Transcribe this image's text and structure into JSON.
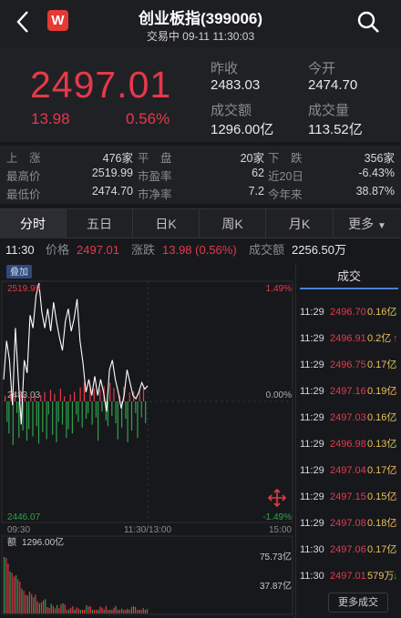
{
  "header": {
    "title": "创业板指(399006)",
    "subtitle": "交易中 09-11 11:30:03",
    "logo_text": "W"
  },
  "quote": {
    "price": "2497.01",
    "change": "13.98",
    "change_pct": "0.56%",
    "prev_close_label": "昨收",
    "prev_close": "2483.03",
    "open_label": "今开",
    "open": "2474.70",
    "turnover_label": "成交额",
    "turnover": "1296.00亿",
    "volume_label": "成交量",
    "volume": "113.52亿"
  },
  "stats": [
    {
      "l1": "上　涨",
      "v1": "476家",
      "l2": "平　盘",
      "v2": "20家",
      "l3": "下　跌",
      "v3": "356家"
    },
    {
      "l1": "最高价",
      "v1": "2519.99",
      "l2": "市盈率",
      "v2": "62",
      "l3": "近20日",
      "v3": "-6.43%"
    },
    {
      "l1": "最低价",
      "v1": "2474.70",
      "l2": "市净率",
      "v2": "7.2",
      "l3": "今年来",
      "v3": "38.87%"
    }
  ],
  "tabs": [
    "分时",
    "五日",
    "日K",
    "周K",
    "月K",
    "更多"
  ],
  "infobar": {
    "time": "11:30",
    "price_label": "价格",
    "price": "2497.01",
    "change_label": "涨跌",
    "change": "13.98 (0.56%)",
    "volume_label": "成交额",
    "volume": "2256.50万"
  },
  "chart": {
    "overlay_btn": "叠加",
    "y_top": "2519.99",
    "y_mid": "2483.03",
    "y_bot": "2446.07",
    "pct_top": "1.49%",
    "pct_mid": "0.00%",
    "pct_bot": "-1.49%",
    "t_start": "09:30",
    "t_mid": "11:30/13:00",
    "t_end": "15:00",
    "vol_title": "额",
    "vol_total": "1296.00亿",
    "vol_top": "75.73亿",
    "vol_mid": "37.87亿"
  },
  "chart_data": {
    "type": "line",
    "title": "",
    "xlabel": "",
    "ylabel": "",
    "ylim": [
      2446.07,
      2519.99
    ],
    "x_ticks": [
      "09:30",
      "11:30/13:00",
      "15:00"
    ],
    "series": [
      {
        "values": [
          2490,
          2502,
          2496,
          2482,
          2506,
          2490,
          2476,
          2496,
          2492,
          2510,
          2506,
          2516,
          2519.99,
          2511,
          2506,
          2512,
          2505,
          2514,
          2508,
          2503,
          2499,
          2508,
          2512,
          2505,
          2509,
          2515,
          2502,
          2495,
          2486,
          2490,
          2485,
          2491,
          2485,
          2490,
          2486,
          2480,
          2493,
          2496,
          2490,
          2486,
          2481,
          2485,
          2493,
          2489,
          2485,
          2484,
          2486,
          2489,
          2487,
          2488
        ]
      }
    ]
  },
  "trades_panel": {
    "title": "成交",
    "more": "更多成交",
    "rows": [
      {
        "t": "11:29",
        "p": "2496.70",
        "v": "0.16亿",
        "dir": "down"
      },
      {
        "t": "11:29",
        "p": "2496.91",
        "v": "0.2亿",
        "dir": "up"
      },
      {
        "t": "11:29",
        "p": "2496.75",
        "v": "0.17亿",
        "dir": "down"
      },
      {
        "t": "11:29",
        "p": "2497.16",
        "v": "0.19亿",
        "dir": "up"
      },
      {
        "t": "11:29",
        "p": "2497.03",
        "v": "0.16亿",
        "dir": "down"
      },
      {
        "t": "11:29",
        "p": "2496.98",
        "v": "0.13亿",
        "dir": "down"
      },
      {
        "t": "11:29",
        "p": "2497.04",
        "v": "0.17亿",
        "dir": "up"
      },
      {
        "t": "11:29",
        "p": "2497.15",
        "v": "0.15亿",
        "dir": "up"
      },
      {
        "t": "11:29",
        "p": "2497.08",
        "v": "0.18亿",
        "dir": "up"
      },
      {
        "t": "11:30",
        "p": "2497.06",
        "v": "0.17亿",
        "dir": "down"
      },
      {
        "t": "11:30",
        "p": "2497.01",
        "v": "579万",
        "dir": "down"
      }
    ]
  },
  "colors": {
    "up": "#e6394a",
    "down": "#2ea34a",
    "accent": "#4a7fd4"
  }
}
